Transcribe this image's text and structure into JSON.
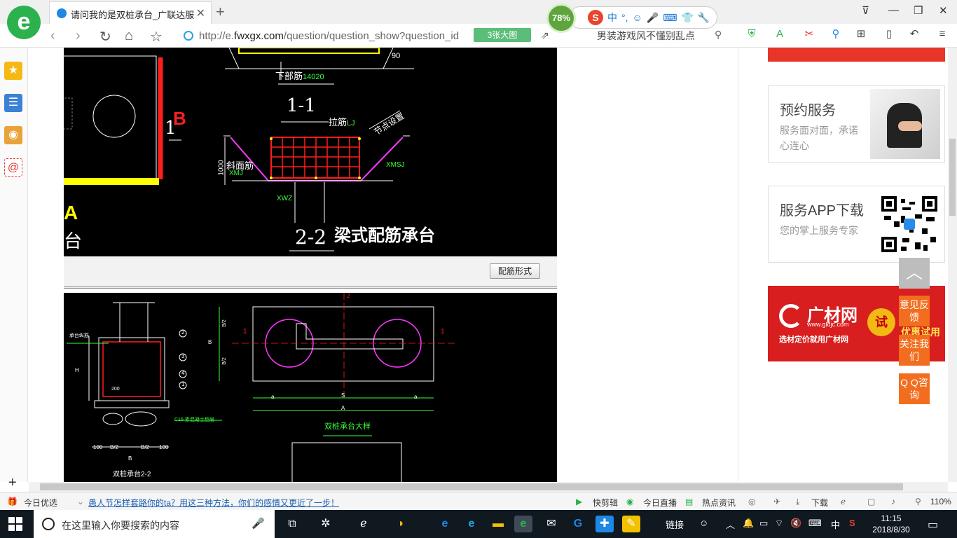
{
  "tab": {
    "title": "请问我的是双桩承台_广联达服务",
    "close_label": "✕"
  },
  "ime": {
    "percent": "78%",
    "items": [
      "中",
      "°,"
    ]
  },
  "window_controls": [
    "⊽",
    "—",
    "❐",
    "✕"
  ],
  "nav": {
    "url_prefix": "http://e.",
    "url_domain": "fwxgx.com",
    "url_rest": "/question/question_show?question_id",
    "image_count": "3张大图",
    "news_search": "男装游戏风不懂别乱点"
  },
  "cad": {
    "section1": "1-1",
    "lower_rebar": "下部筋",
    "lower_rebar_code": "14020",
    "section2": "2-2",
    "tie_rebar": "拉筋",
    "tie_rebar_code": "LJ",
    "slope_rebar": "斜面筋",
    "slope_code": "XMJ",
    "height": "1000",
    "xmsj": "XMSJ",
    "xwz": "XWZ",
    "diag_note": "节点设置",
    "angle": "90",
    "marker_a": "A",
    "marker_b": "B",
    "marker_1": "1",
    "partial_char": "台",
    "title": "梁式配筋承台",
    "twin_pile_detail": "双桩承台大样",
    "twin_pile_section": "双桩承台2-2",
    "cushion": "C15 素混凝土垫层",
    "pile_cap_rebar": "承台纵筋",
    "dim_b": "B",
    "dim_b2": "B/2",
    "dim_100": "100",
    "dim_a": "A",
    "dim_s": "S",
    "dim_a_small": "a",
    "callouts": [
      "1",
      "2",
      "3",
      "4",
      "5"
    ],
    "dim_h": "H",
    "dim_200": "200",
    "dim_2": "2",
    "dim_1": "1"
  },
  "rebar_button": "配筋形式",
  "ads": {
    "appointment": {
      "title": "预约服务",
      "desc": "服务面对面，承诺心连心"
    },
    "app_download": {
      "title": "服务APP下载",
      "desc": "您的掌上服务专家"
    },
    "guangcai": {
      "brand": "广材网",
      "site": "www.gldjc.com",
      "slogan": "选材定价就用广材网",
      "trial": "试",
      "promo": "优惠试用"
    }
  },
  "float_buttons": {
    "top": "︿",
    "feedback": "意见反馈",
    "follow": "关注我们",
    "qq": "Q Q咨询"
  },
  "status": {
    "today_pick": "今日优选",
    "headline": "愚人节怎样套路你的ta？用这三种方法，你们的感情又更近了一步！",
    "kuaijianji": "快剪辑",
    "live": "今日直播",
    "hot_news": "热点资讯",
    "download": "下载",
    "zoom": "110%"
  },
  "taskbar": {
    "search_placeholder": "在这里输入你要搜索的内容",
    "links": "链接",
    "ime": "中",
    "time": "11:15",
    "date": "2018/8/30"
  },
  "colors": {
    "accent_green": "#2bb24c",
    "status_orange": "#f26d1d",
    "cad_bg": "#000000",
    "taskbar": "#101820"
  }
}
